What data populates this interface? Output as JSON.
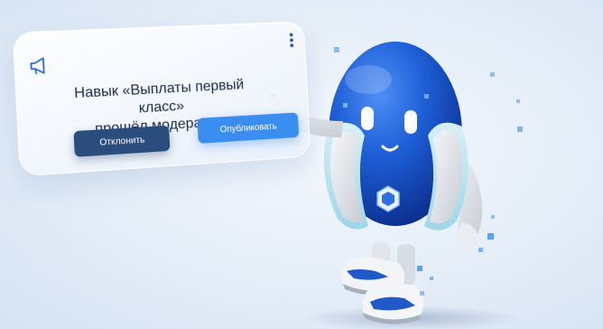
{
  "notification": {
    "icon": "megaphone-icon",
    "menu_icon": "kebab-menu-icon",
    "message_line1": "Навык «Выплаты первый класс»",
    "message_line2": "прошёл модерацию",
    "reject_label": "Отклонить",
    "publish_label": "Опубликовать"
  },
  "colors": {
    "background": "#e6eef8",
    "accent": "#2f6fd6",
    "reject_button": "#2a4d7e",
    "publish_button": "#3a8ef0",
    "text": "#1c2b48"
  }
}
